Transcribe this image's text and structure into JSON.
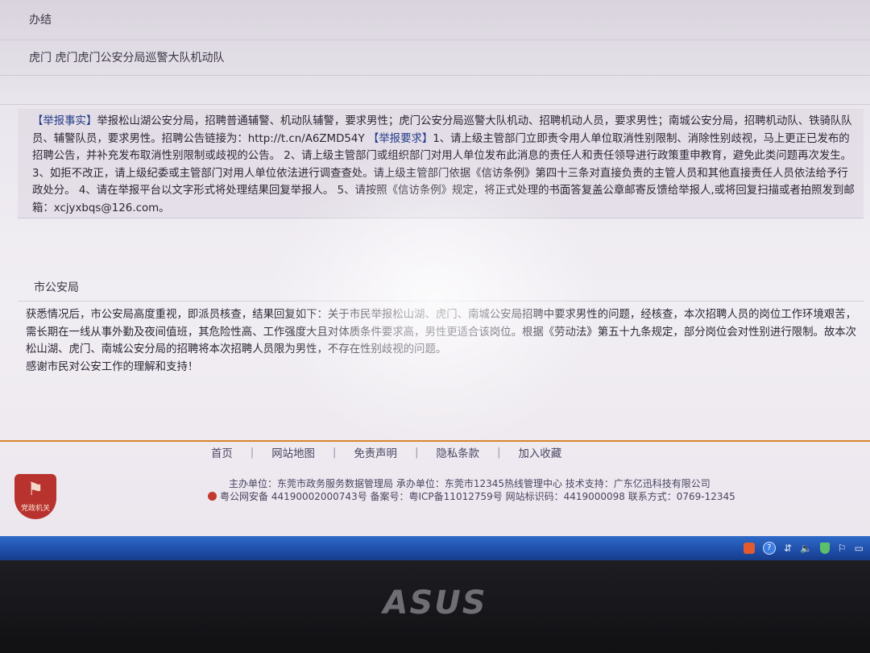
{
  "rows": {
    "handling_unit": "办结",
    "department": "虎门 虎门虎门公安分局巡警大队机动队"
  },
  "report": {
    "tag_facts": "【举报事实】",
    "facts": "举报松山湖公安分局，招聘普通辅警、机动队辅警，要求男性；虎门公安分局巡警大队机动、招聘机动人员，要求男性；南城公安分局，招聘机动队、铁骑队队员、辅警队员，要求男性。招聘公告链接为：http://t.cn/A6ZMD54Y ",
    "tag_requests": "【举报要求】",
    "requests": "1、请上级主管部门立即责令用人单位取消性别限制、消除性别歧视，马上更正已发布的招聘公告，并补充发布取消性别限制或歧视的公告。 2、请上级主管部门或组织部门对用人单位发布此消息的责任人和责任领导进行政策重申教育，避免此类问题再次发生。 3、如拒不改正，请上级纪委或主管部门对用人单位依法进行调查查处。请上级主管部门依据《信访条例》第四十三条对直接负责的主管人员和其他直接责任人员依法给予行政处分。 4、请在举报平台以文字形式将处理结果回复举报人。 5、请按照《信访条例》规定，将正式处理的书面答复盖公章邮寄反馈给举报人,或将回复扫描或者拍照发到邮箱：xcjyxbqs@126.com。"
  },
  "reply": {
    "from": "市公安局",
    "body": "获悉情况后，市公安局高度重视，即派员核查，结果回复如下：关于市民举报松山湖、虎门、南城公安局招聘中要求男性的问题，经核查，本次招聘人员的岗位工作环境艰苦，需长期在一线从事外勤及夜间值班，其危险性高、工作强度大且对体质条件要求高，男性更适合该岗位。根据《劳动法》第五十九条规定，部分岗位会对性别进行限制。故本次松山湖、虎门、南城公安分局的招聘将本次招聘人员限为男性，不存在性别歧视的问题。",
    "thanks": "感谢市民对公安工作的理解和支持！"
  },
  "footer": {
    "nav": [
      "首页",
      "网站地图",
      "免责声明",
      "隐私条款",
      "加入收藏"
    ],
    "emblem_label": "党政机关",
    "info_line1": "主办单位：东莞市政务服务数据管理局 承办单位：东莞市12345热线管理中心 技术支持：广东亿迅科技有限公司",
    "info_line2": "粤公网安备 44190002000743号 备案号：粤ICP备11012759号 网站标识码：4419000098 联系方式：0769-12345"
  },
  "taskbar": {
    "help_glyph": "?"
  },
  "bezel": {
    "brand": "ASUS"
  }
}
